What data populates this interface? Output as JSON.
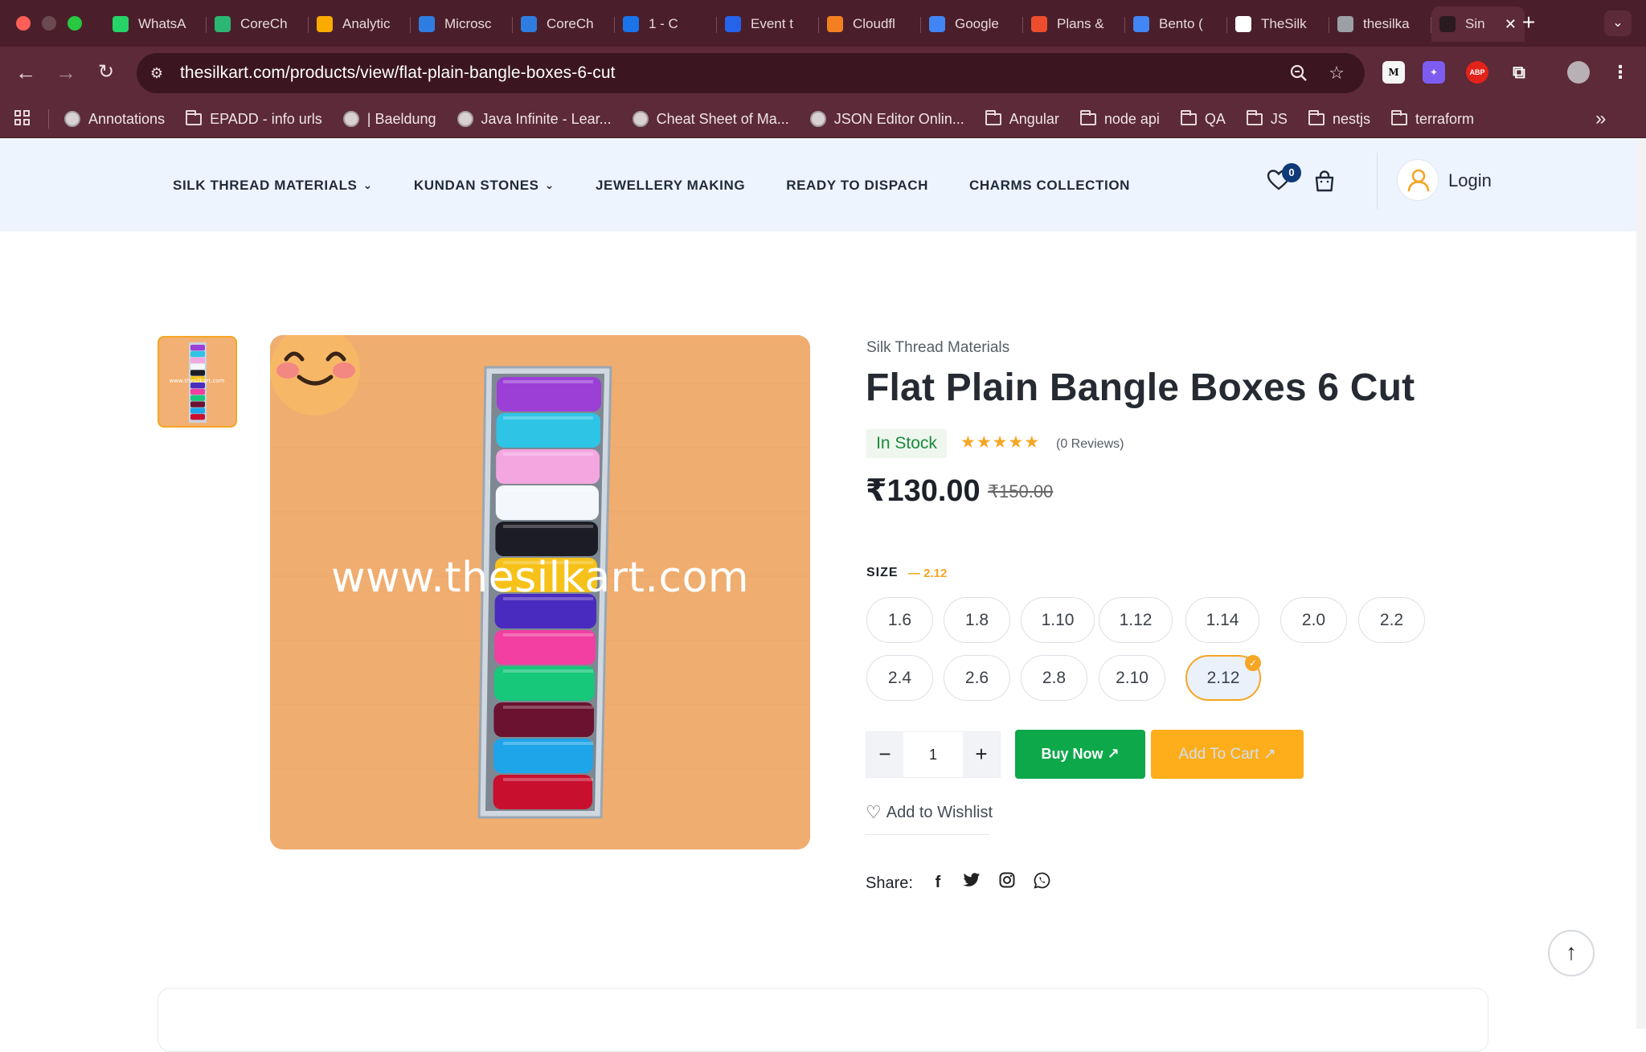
{
  "browser": {
    "tabs": [
      {
        "label": "WhatsA",
        "color": "#25d366"
      },
      {
        "label": "CoreCh",
        "color": "#2bb673"
      },
      {
        "label": "Analytic",
        "color": "#f9ab00"
      },
      {
        "label": "Microsc",
        "color": "#2f7de1"
      },
      {
        "label": "CoreCh",
        "color": "#2f7de1"
      },
      {
        "label": "1 - C",
        "color": "#1a73e8"
      },
      {
        "label": "Event t",
        "color": "#2563eb"
      },
      {
        "label": "Cloudfl",
        "color": "#f38020"
      },
      {
        "label": "Google",
        "color": "#4285f4"
      },
      {
        "label": "Plans &",
        "color": "#ee4d2d"
      },
      {
        "label": "Bento (",
        "color": "#4285f4"
      },
      {
        "label": "TheSilk",
        "color": "#ffffff"
      },
      {
        "label": "thesilka",
        "color": "#9aa0a6"
      }
    ],
    "active_tab": {
      "label": "Sin",
      "close": "✕"
    },
    "new_tab": "+",
    "url": "thesilkart.com/products/view/flat-plain-bangle-boxes-6-cut",
    "bookmarks": [
      {
        "label": "Annotations",
        "icon": "globe"
      },
      {
        "label": "EPADD - info urls",
        "icon": "folder"
      },
      {
        "label": "| Baeldung",
        "icon": "globe"
      },
      {
        "label": "Java Infinite - Lear...",
        "icon": "globe"
      },
      {
        "label": "Cheat Sheet of Ma...",
        "icon": "globe"
      },
      {
        "label": "JSON Editor Onlin...",
        "icon": "globe"
      },
      {
        "label": "Angular",
        "icon": "folder"
      },
      {
        "label": "node api",
        "icon": "folder"
      },
      {
        "label": "QA",
        "icon": "folder"
      },
      {
        "label": "JS",
        "icon": "folder"
      },
      {
        "label": "nestjs",
        "icon": "folder"
      },
      {
        "label": "terraform",
        "icon": "folder"
      }
    ],
    "extensions": [
      "M",
      "ABP"
    ]
  },
  "site": {
    "nav": [
      {
        "label": "SILK THREAD MATERIALS",
        "dropdown": true
      },
      {
        "label": "KUNDAN STONES",
        "dropdown": true
      },
      {
        "label": "JEWELLERY MAKING",
        "dropdown": false
      },
      {
        "label": "READY TO DISPACH",
        "dropdown": false
      },
      {
        "label": "CHARMS COLLECTION",
        "dropdown": false
      }
    ],
    "wishlist_count": "0",
    "login_label": "Login"
  },
  "product": {
    "image_watermark": "www.thesilkart.com",
    "thumb_watermark": "www.thesilkart.com",
    "category": "Silk Thread Materials",
    "title": "Flat Plain Bangle Boxes 6 Cut",
    "stock": "In Stock",
    "rating": 5,
    "reviews": "(0 Reviews)",
    "price": "₹130.00",
    "old_price": "₹150.00",
    "size_label": "SIZE",
    "size_selected": "— 2.12",
    "sizes": [
      "1.6",
      "1.8",
      "1.10",
      "1.12",
      "1.14",
      "2.0",
      "2.2",
      "2.4",
      "2.6",
      "2.8",
      "2.10",
      "2.12"
    ],
    "active_size": "2.12",
    "quantity": "1",
    "buy_now": "Buy Now ↗",
    "add_to_cart": "Add To Cart ↗",
    "add_to_wishlist": "Add to Wishlist",
    "share_label": "Share:",
    "share_icons": [
      "facebook-icon",
      "twitter-icon",
      "instagram-icon",
      "whatsapp-icon"
    ],
    "bangle_colors": [
      "#9b3fd6",
      "#2ec4e6",
      "#f3a6e0",
      "#f4f7fb",
      "#1c1c24",
      "#f6c21a",
      "#4a2bbf",
      "#f23fa1",
      "#17c77a",
      "#6b1230",
      "#1ea4e8",
      "#c8102e"
    ]
  },
  "colors": {
    "accent": "#f5a623",
    "buy_green": "#0da84a",
    "cart_orange": "#fdae1a",
    "header_bg": "#eef4fd"
  }
}
